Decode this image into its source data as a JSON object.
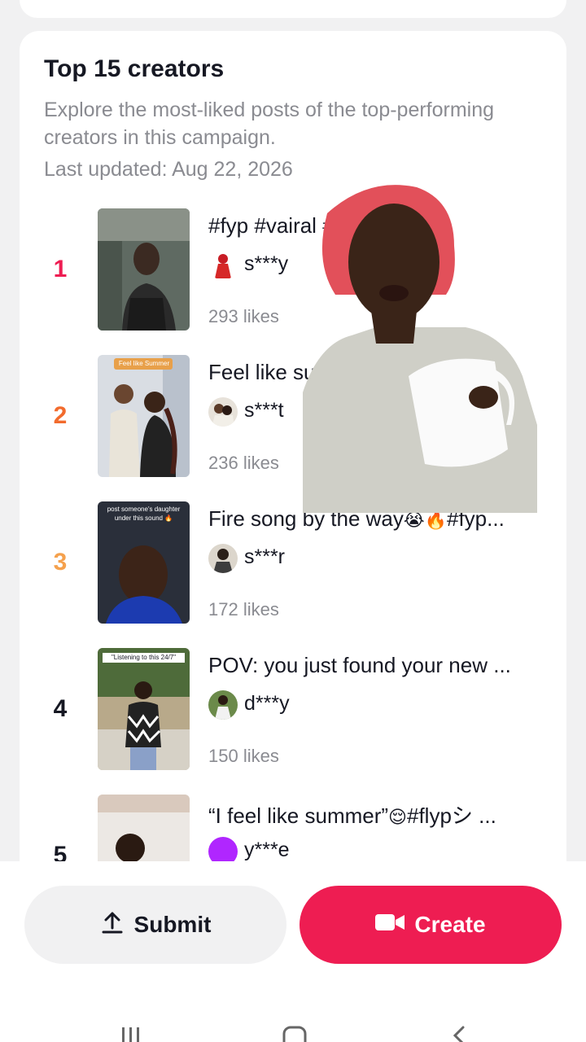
{
  "section": {
    "title": "Top 15 creators",
    "description": "Explore the most-liked posts of the top-performing creators in this campaign.",
    "last_updated": "Last updated: Aug 22, 2026"
  },
  "colors": {
    "rank1": "#ee1d52",
    "rank2": "#f26b2d",
    "rank3": "#f5a14d",
    "rank_default": "#161823",
    "accent": "#ee1d52"
  },
  "creators": [
    {
      "rank": "1",
      "title": "#fyp #vairal #viral #viral",
      "handle": "s***y",
      "likes": "293 likes"
    },
    {
      "rank": "2",
      "title": "Feel like summer",
      "handle": "s***t",
      "likes": "236 likes"
    },
    {
      "rank": "3",
      "title": "Fire song by the way",
      "title_emoji": "😭🔥",
      "title_tail": "#fyp...",
      "handle": "s***r",
      "likes": "172 likes",
      "thumb_caption": "post someone's daughter under this sound 🔥"
    },
    {
      "rank": "4",
      "title": "POV: you just found your new ...",
      "handle": "d***y",
      "likes": "150 likes",
      "thumb_caption": "\"Listening to this 24/7\""
    },
    {
      "rank": "5",
      "title": "“I feel like summer”",
      "title_emoji": "😌",
      "title_tail": "#flypシ ...",
      "handle": "y***e"
    }
  ],
  "thumb2_caption": "Feel like Summer",
  "buttons": {
    "submit_label": "Submit",
    "submit_icon": "upload-icon",
    "create_label": "Create",
    "create_icon": "video-camera-icon"
  },
  "system_nav": [
    "recent-apps-icon",
    "home-icon",
    "back-icon"
  ]
}
